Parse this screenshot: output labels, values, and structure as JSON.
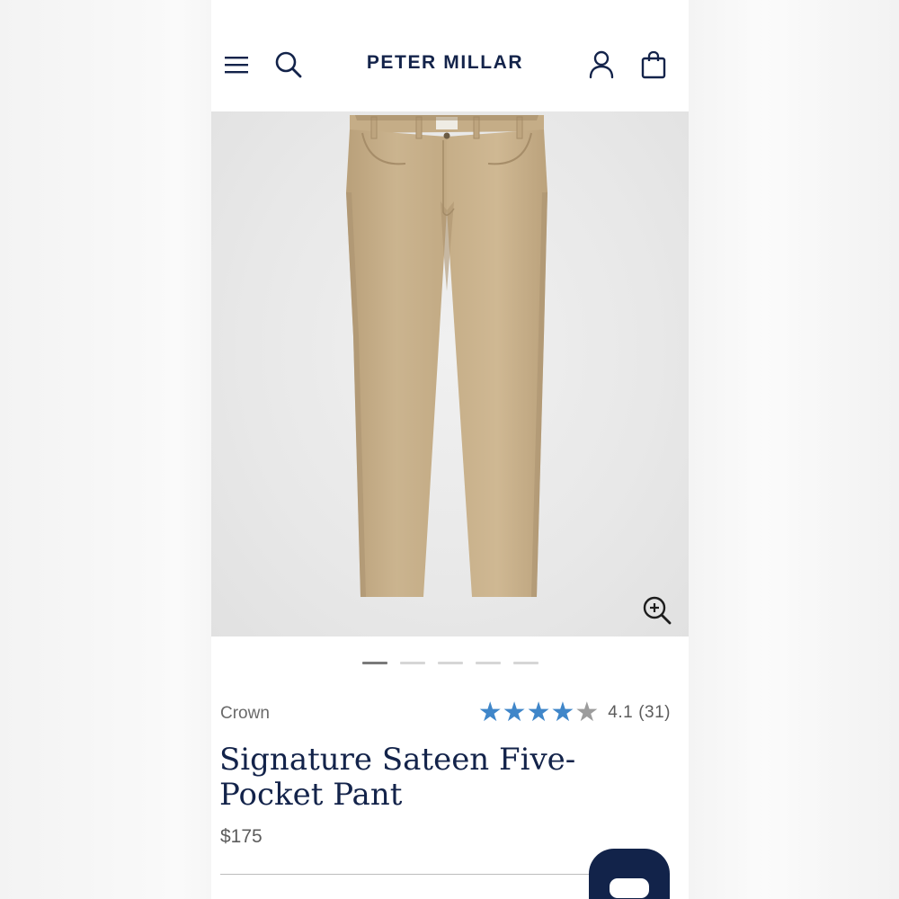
{
  "header": {
    "logo": "PETER MILLAR",
    "menu_icon": "hamburger-menu-icon",
    "search_icon": "search-icon",
    "account_icon": "user-icon",
    "bag_icon": "shopping-bag-icon"
  },
  "hero": {
    "zoom_icon": "zoom-in-icon",
    "slide_count": 5,
    "active_slide": 1
  },
  "product": {
    "brand": "Crown",
    "rating": "4.1",
    "review_count": "(31)",
    "rating_value": 4.1,
    "rating_max": 5,
    "title": "Signature Sateen Five-Pocket Pant",
    "price": "$175"
  },
  "chat": {
    "icon": "chat-icon"
  },
  "colors": {
    "navy": "#13234a",
    "star_blue": "#3f86c9",
    "khaki": "#c7b08b"
  }
}
